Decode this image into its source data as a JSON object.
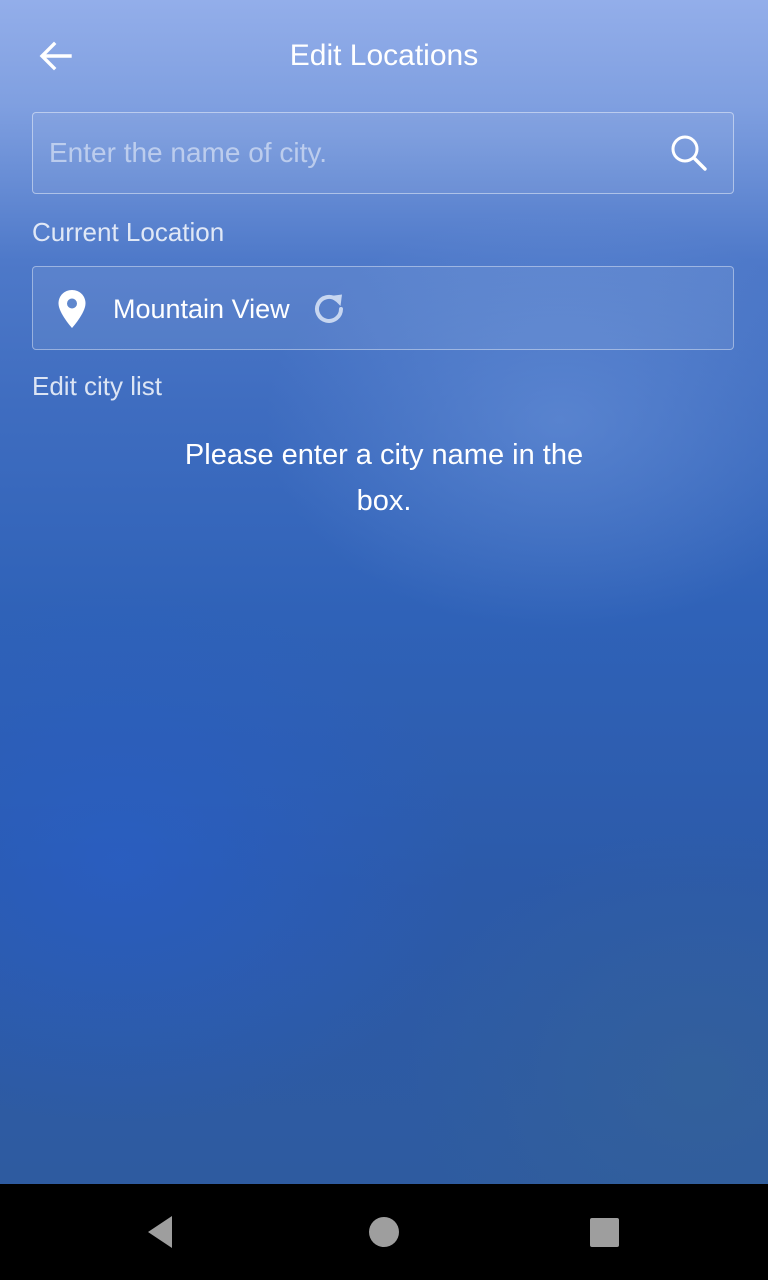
{
  "header": {
    "title": "Edit Locations",
    "back_icon": "arrow-left-icon"
  },
  "search": {
    "placeholder": "Enter the name of city.",
    "value": "",
    "icon": "search-icon"
  },
  "current_location": {
    "section_label": "Current Location",
    "city": "Mountain View",
    "pin_icon": "map-pin-icon",
    "refresh_icon": "refresh-icon"
  },
  "city_list": {
    "section_label": "Edit city list",
    "empty_message": "Please enter a city name in the box."
  },
  "system_nav": {
    "back_icon": "nav-back-triangle-icon",
    "home_icon": "nav-home-circle-icon",
    "recents_icon": "nav-recents-square-icon"
  },
  "colors": {
    "background_top": "#93aeea",
    "background_bottom": "#2e5ba0",
    "text": "#ffffff",
    "nav_bar": "#000000",
    "nav_icons": "#9e9e9e"
  }
}
